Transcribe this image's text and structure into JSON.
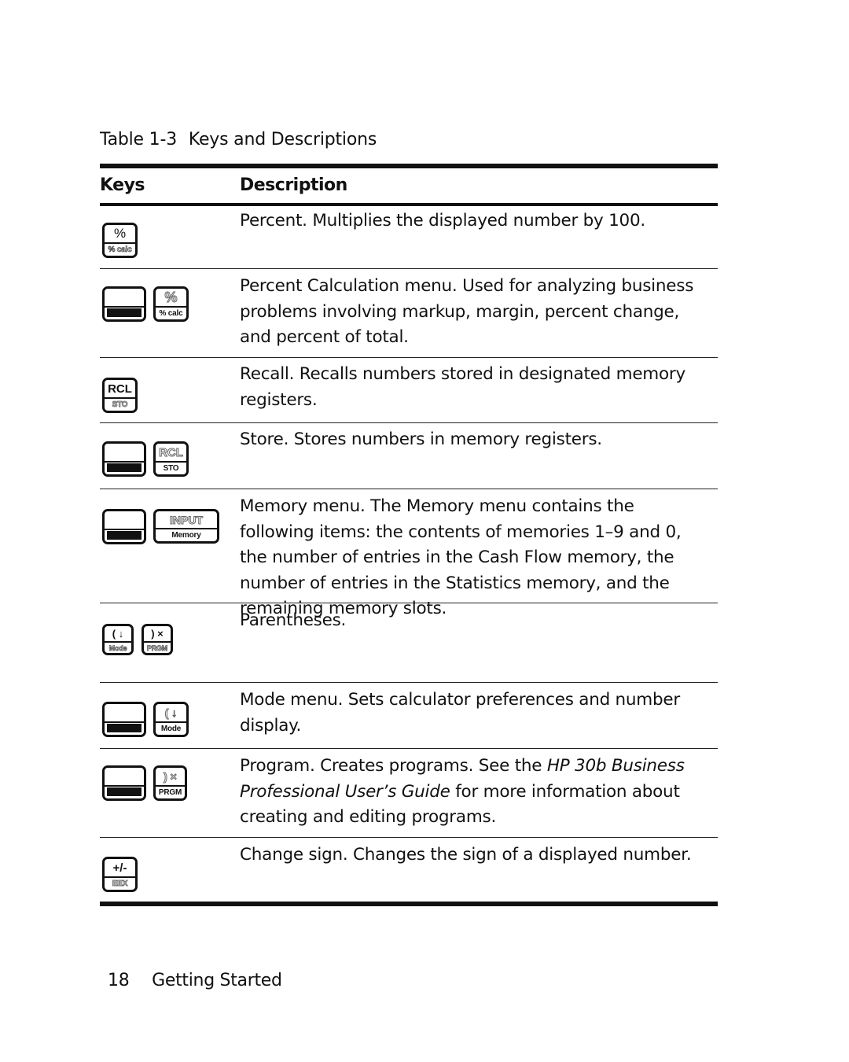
{
  "caption": {
    "number": "Table 1-3",
    "title": "Keys and Descriptions"
  },
  "table": {
    "headers": {
      "keys": "Keys",
      "description": "Description"
    },
    "rows": [
      {
        "keys": [
          {
            "type": "key",
            "top": "%",
            "bottom": "% calc",
            "active": "top",
            "icon": "percent-key-icon"
          }
        ],
        "description": "Percent. Multiplies the displayed number by 100."
      },
      {
        "keys": [
          {
            "type": "shift",
            "icon": "shift-key-icon"
          },
          {
            "type": "key",
            "top": "%",
            "bottom": "% calc",
            "active": "bottom",
            "icon": "percent-calc-key-icon"
          }
        ],
        "description": "Percent Calculation menu. Used for analyzing business problems involving markup, margin, percent change, and percent of total."
      },
      {
        "keys": [
          {
            "type": "key",
            "top": "RCL",
            "bottom": "STO",
            "active": "top",
            "icon": "rcl-key-icon"
          }
        ],
        "description": "Recall. Recalls numbers stored in designated memory registers."
      },
      {
        "keys": [
          {
            "type": "shift",
            "icon": "shift-key-icon"
          },
          {
            "type": "key",
            "top": "RCL",
            "bottom": "STO",
            "active": "bottom",
            "icon": "sto-key-icon"
          }
        ],
        "description": "Store. Stores numbers in memory registers."
      },
      {
        "keys": [
          {
            "type": "shift",
            "icon": "shift-key-icon"
          },
          {
            "type": "key",
            "top": "INPUT",
            "bottom": "Memory",
            "active": "bottom",
            "icon": "memory-key-icon"
          }
        ],
        "description": "Memory menu. The Memory menu contains the following items: the contents of memories 1–9 and 0, the number of entries in the Cash Flow memory, the number of entries in the Statistics memory, and the remaining memory slots."
      },
      {
        "keys": [
          {
            "type": "key",
            "top": "( ↓",
            "bottom": "Mode",
            "active": "top",
            "icon": "open-paren-key-icon"
          },
          {
            "type": "key",
            "top": ") ×",
            "bottom": "PRGM",
            "active": "top",
            "icon": "close-paren-key-icon"
          }
        ],
        "description": "Parentheses."
      },
      {
        "keys": [
          {
            "type": "shift",
            "icon": "shift-key-icon"
          },
          {
            "type": "key",
            "top": "( ↓",
            "bottom": "Mode",
            "active": "bottom",
            "icon": "mode-key-icon"
          }
        ],
        "description": "Mode menu. Sets calculator preferences and number display."
      },
      {
        "keys": [
          {
            "type": "shift",
            "icon": "shift-key-icon"
          },
          {
            "type": "key",
            "top": ") ×",
            "bottom": "PRGM",
            "active": "bottom",
            "icon": "prgm-key-icon"
          }
        ],
        "description_parts": [
          "Program. Creates programs. See the ",
          "HP 30b Business Professional User’s Guide",
          " for more information about creating and editing programs."
        ]
      },
      {
        "keys": [
          {
            "type": "key",
            "top": "+/-",
            "bottom": "EEX",
            "active": "top",
            "icon": "change-sign-key-icon"
          }
        ],
        "description": "Change sign. Changes the sign of a displayed number."
      }
    ]
  },
  "footer": {
    "page_number": "18",
    "section": "Getting Started"
  }
}
